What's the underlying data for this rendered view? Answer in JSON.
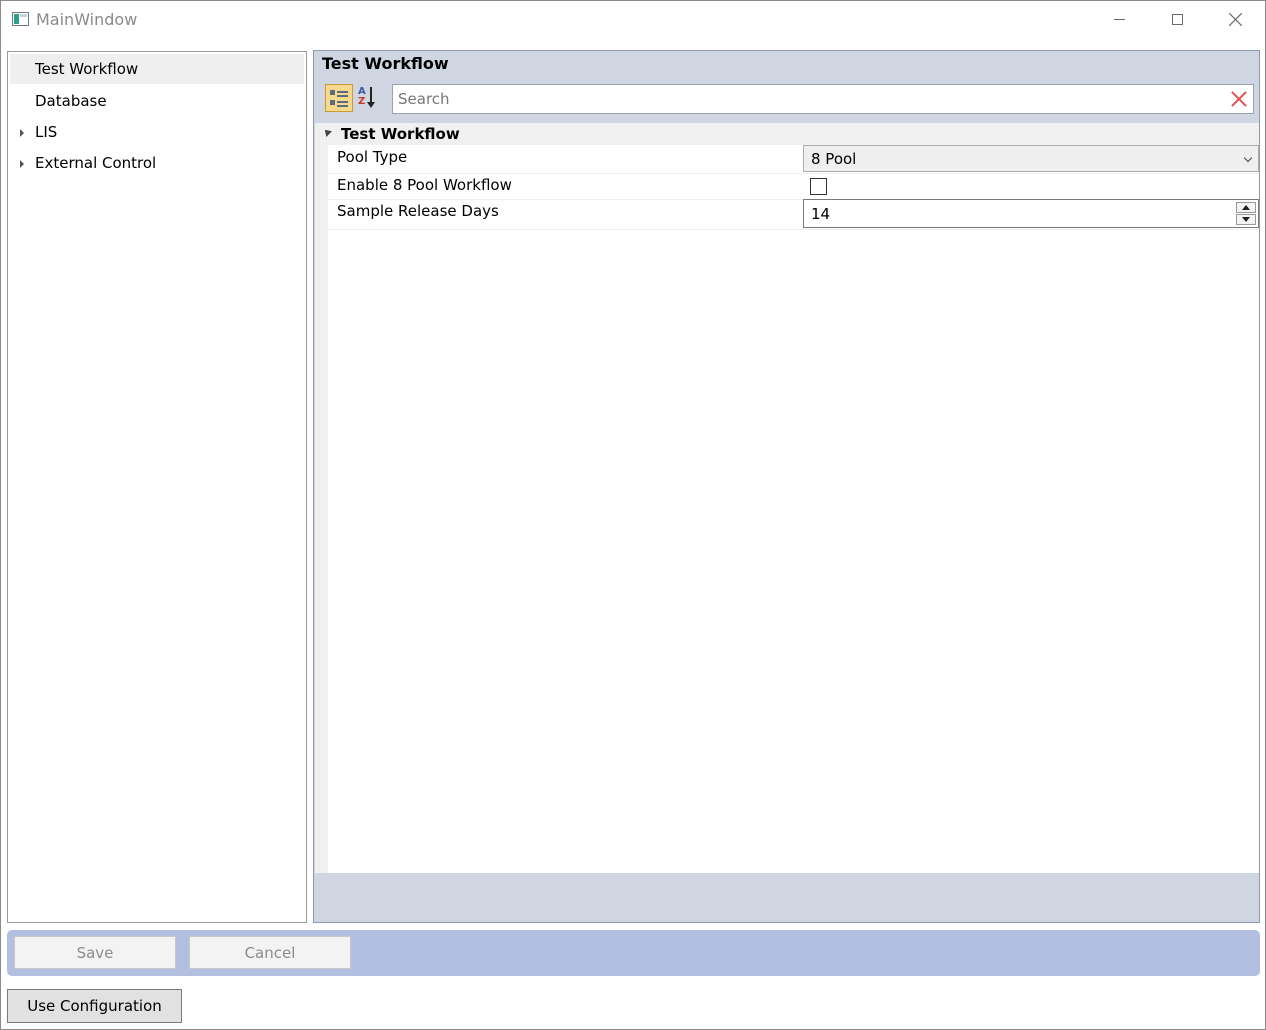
{
  "window": {
    "title": "MainWindow",
    "min_icon": "minimize-icon",
    "max_icon": "maximize-icon",
    "close_icon": "close-icon"
  },
  "tree": {
    "items": [
      {
        "label": "Test Workflow",
        "selected": true,
        "expandable": false
      },
      {
        "label": "Database",
        "selected": false,
        "expandable": false
      },
      {
        "label": "LIS",
        "selected": false,
        "expandable": true
      },
      {
        "label": "External Control",
        "selected": false,
        "expandable": true
      }
    ]
  },
  "property_grid": {
    "header": "Test Workflow",
    "search_placeholder": "Search",
    "category": "Test Workflow",
    "properties": [
      {
        "name": "Pool Type",
        "value": "8 Pool",
        "editor": "dropdown"
      },
      {
        "name": "Enable 8 Pool Workflow",
        "value": false,
        "editor": "checkbox"
      },
      {
        "name": "Sample Release Days",
        "value": "14",
        "editor": "numeric-spinner"
      }
    ]
  },
  "actions": {
    "save_label": "Save",
    "cancel_label": "Cancel",
    "use_config_label": "Use Configuration"
  },
  "colors": {
    "action_bar": "#b3bfe0",
    "grid_background": "#cfd6e1",
    "selected_tree_item": "#efefef",
    "clear_icon": "#e05252"
  }
}
